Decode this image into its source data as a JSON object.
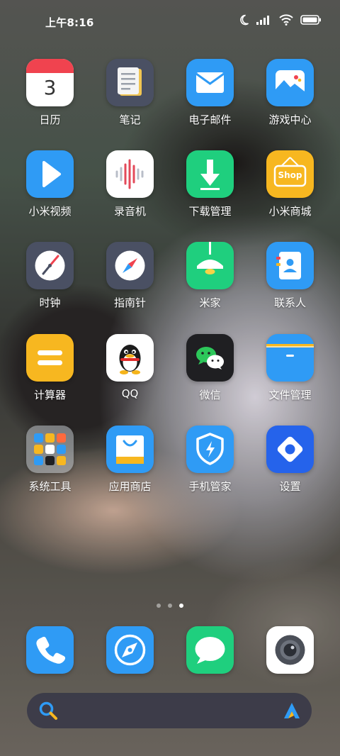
{
  "status_bar": {
    "time": "上午8:16",
    "icons": [
      "moon-icon",
      "signal-icon",
      "wifi-icon",
      "battery-icon"
    ]
  },
  "apps": [
    {
      "name": "calendar",
      "label": "日历",
      "badge_text": "3",
      "color": "#ffffff"
    },
    {
      "name": "notes",
      "label": "笔记",
      "color": "#4a5063"
    },
    {
      "name": "email",
      "label": "电子邮件",
      "color": "#2f9bf5"
    },
    {
      "name": "game-center",
      "label": "游戏中心",
      "color": "#2f9bf5"
    },
    {
      "name": "mi-video",
      "label": "小米视频",
      "color": "#2f9bf5"
    },
    {
      "name": "recorder",
      "label": "录音机",
      "color": "#ffffff"
    },
    {
      "name": "downloads",
      "label": "下载管理",
      "color": "#1fcf7e"
    },
    {
      "name": "mi-store",
      "label": "小米商城",
      "shop_text": "Shop",
      "color": "#f7b720"
    },
    {
      "name": "clock",
      "label": "时钟",
      "color": "#4a5063"
    },
    {
      "name": "compass",
      "label": "指南针",
      "color": "#4a5063"
    },
    {
      "name": "mi-home",
      "label": "米家",
      "color": "#1fcf7e"
    },
    {
      "name": "contacts",
      "label": "联系人",
      "color": "#2f9bf5"
    },
    {
      "name": "calculator",
      "label": "计算器",
      "color": "#f7b720"
    },
    {
      "name": "qq",
      "label": "QQ",
      "color": "#ffffff"
    },
    {
      "name": "wechat",
      "label": "微信",
      "color": "#1f1f22"
    },
    {
      "name": "file-manager",
      "label": "文件管理",
      "color": "#2f9bf5"
    },
    {
      "name": "system-tools-folder",
      "label": "系统工具",
      "color": "#9aa0a8"
    },
    {
      "name": "app-store",
      "label": "应用商店",
      "color": "#2f9bf5"
    },
    {
      "name": "security",
      "label": "手机管家",
      "color": "#2f9bf5"
    },
    {
      "name": "settings",
      "label": "设置",
      "color": "#2563eb"
    }
  ],
  "page_indicator": {
    "count": 3,
    "active_index": 2
  },
  "dock": [
    {
      "name": "phone",
      "color": "#2f9bf5"
    },
    {
      "name": "browser",
      "color": "#2f9bf5"
    },
    {
      "name": "messages",
      "color": "#1fcf7e"
    },
    {
      "name": "camera",
      "color": "#ffffff"
    }
  ],
  "search_bar": {
    "left_icon": "search-icon",
    "right_icon": "xiaoai-assistant-icon"
  }
}
